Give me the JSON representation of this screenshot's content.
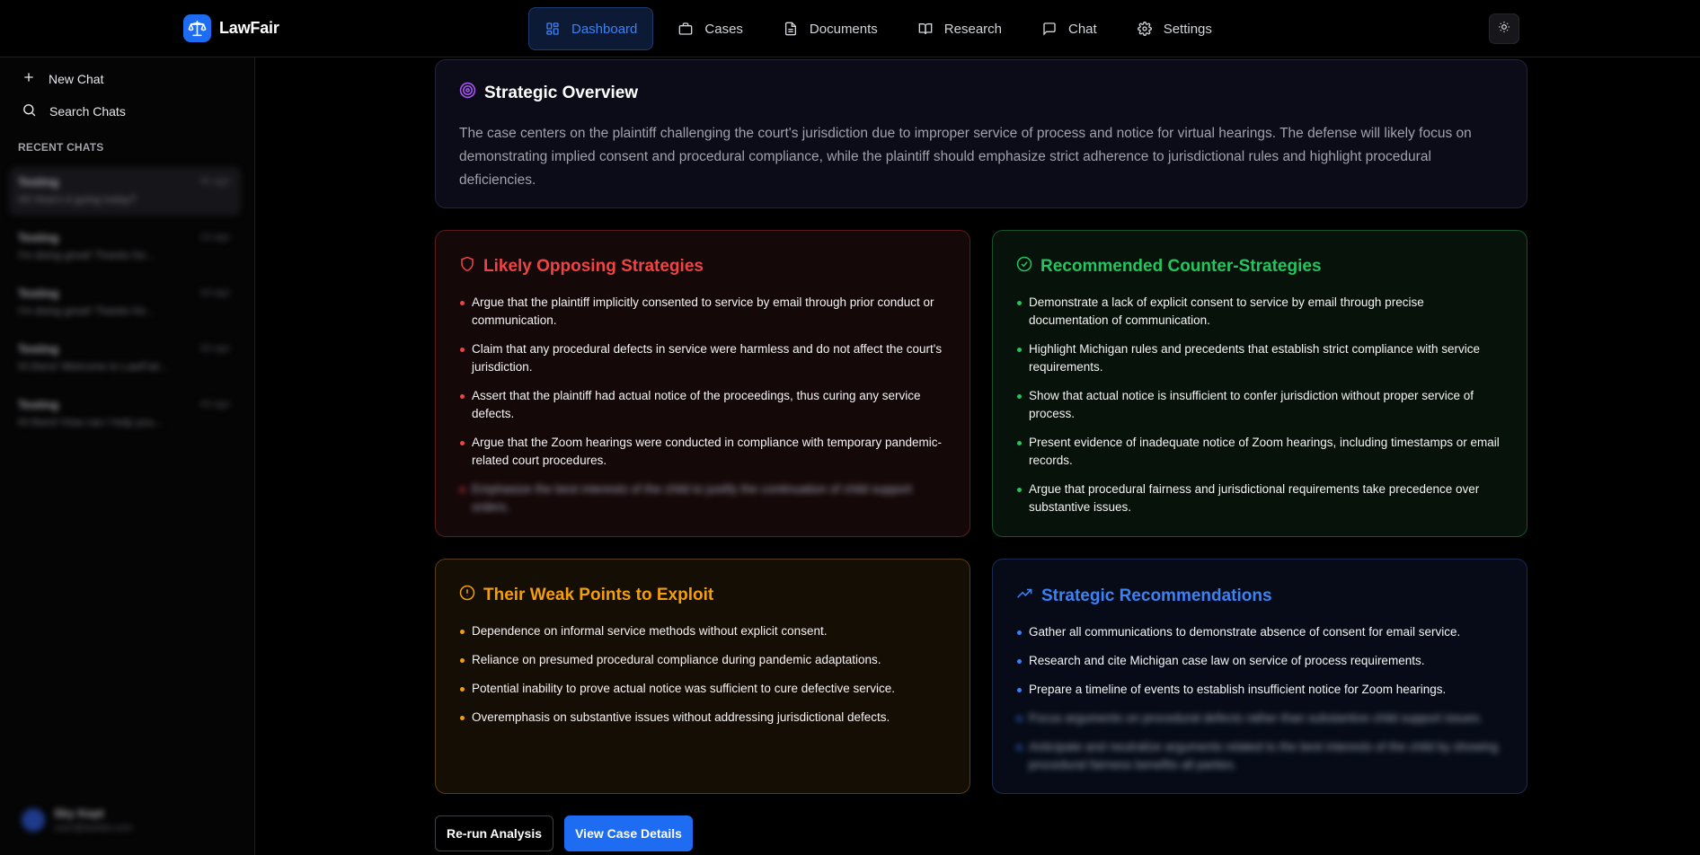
{
  "app": {
    "name": "LawFair"
  },
  "nav": [
    {
      "label": "Dashboard",
      "icon": "dashboard-icon",
      "active": true
    },
    {
      "label": "Cases",
      "icon": "briefcase-icon"
    },
    {
      "label": "Documents",
      "icon": "document-icon"
    },
    {
      "label": "Research",
      "icon": "book-icon"
    },
    {
      "label": "Chat",
      "icon": "chat-icon"
    },
    {
      "label": "Settings",
      "icon": "gear-icon"
    }
  ],
  "sidebar": {
    "new_chat": "New Chat",
    "search_chats": "Search Chats",
    "recent_label": "RECENT CHATS",
    "chats": [
      {
        "title": "Testing",
        "time": "4h ago",
        "preview": "Hi! How's it going today?"
      },
      {
        "title": "Testing",
        "time": "1d ago",
        "preview": "I'm doing great! Thanks for..."
      },
      {
        "title": "Testing",
        "time": "2d ago",
        "preview": "I'm doing great! Thanks for..."
      },
      {
        "title": "Testing",
        "time": "3d ago",
        "preview": "Hi there! Welcome to LawFair..."
      },
      {
        "title": "Testing",
        "time": "4d ago",
        "preview": "Hi there! How can I help you..."
      }
    ],
    "user": {
      "name": "Sky Kept",
      "email": "user@lawfair.com"
    }
  },
  "overview": {
    "title": "Strategic Overview",
    "text": "The case centers on the plaintiff challenging the court's jurisdiction due to improper service of process and notice for virtual hearings. The defense will likely focus on demonstrating implied consent and procedural compliance, while the plaintiff should emphasize strict adherence to jurisdictional rules and highlight procedural deficiencies."
  },
  "opposing": {
    "title": "Likely Opposing Strategies",
    "items": [
      "Argue that the plaintiff implicitly consented to service by email through prior conduct or communication.",
      "Claim that any procedural defects in service were harmless and do not affect the court's jurisdiction.",
      "Assert that the plaintiff had actual notice of the proceedings, thus curing any service defects.",
      "Argue that the Zoom hearings were conducted in compliance with temporary pandemic-related court procedures.",
      "Emphasize the best interests of the child to justify the continuation of child support orders."
    ]
  },
  "counter": {
    "title": "Recommended Counter-Strategies",
    "items": [
      "Demonstrate a lack of explicit consent to service by email through precise documentation of communication.",
      "Highlight Michigan rules and precedents that establish strict compliance with service requirements.",
      "Show that actual notice is insufficient to confer jurisdiction without proper service of process.",
      "Present evidence of inadequate notice of Zoom hearings, including timestamps or email records.",
      "Argue that procedural fairness and jurisdictional requirements take precedence over substantive issues."
    ]
  },
  "weak": {
    "title": "Their Weak Points to Exploit",
    "items": [
      "Dependence on informal service methods without explicit consent.",
      "Reliance on presumed procedural compliance during pandemic adaptations.",
      "Potential inability to prove actual notice was sufficient to cure defective service.",
      "Overemphasis on substantive issues without addressing jurisdictional defects."
    ]
  },
  "recs": {
    "title": "Strategic Recommendations",
    "items": [
      "Gather all communications to demonstrate absence of consent for email service.",
      "Research and cite Michigan case law on service of process requirements.",
      "Prepare a timeline of events to establish insufficient notice for Zoom hearings.",
      "Focus arguments on procedural defects rather than substantive child support issues.",
      "Anticipate and neutralize arguments related to the best interests of the child by showing procedural fairness benefits all parties."
    ]
  },
  "buttons": {
    "rerun": "Re-run Analysis",
    "view": "View Case Details"
  },
  "colors": {
    "accent": "#1d6cf2",
    "red": "#ef4444",
    "green": "#22c55e",
    "amber": "#f59e0b",
    "blue": "#3b82f6",
    "violet": "#a855f7"
  }
}
